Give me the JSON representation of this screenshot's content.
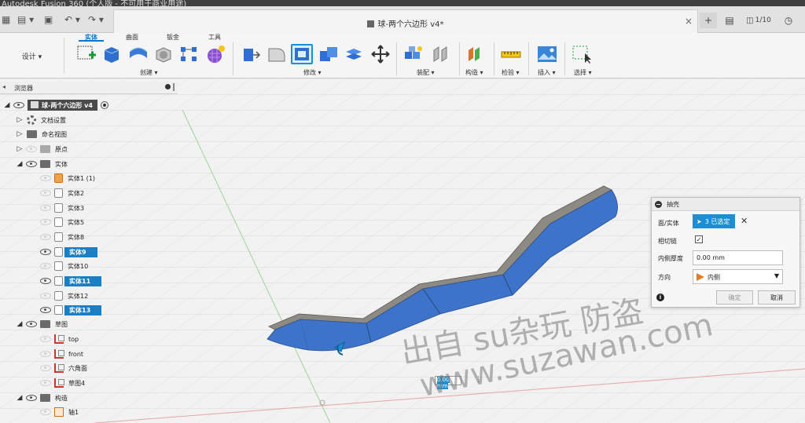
{
  "window": {
    "title": "Autodesk Fusion 360 (个人版 - 不可用于商业用途)"
  },
  "document_tab": {
    "title": "球-两个六边形 v4*",
    "close": "×"
  },
  "quick_access": {
    "grid": "▦",
    "file": "▤ ▾",
    "save": "▣",
    "undo": "↶ ▾",
    "redo": "↷ ▾"
  },
  "top_right": {
    "add_tab": "+",
    "chat": "▤",
    "jobs": "1/10",
    "clock": "◷"
  },
  "toolbar": {
    "design": "设计 ▾",
    "tabs": [
      "实体",
      "曲面",
      "钣金",
      "工具"
    ],
    "groups": {
      "create": "创建 ▾",
      "modify": "修改 ▾",
      "assemble": "装配 ▾",
      "construct": "构造 ▾",
      "inspect": "检验 ▾",
      "insert": "插入 ▾",
      "select": "选择 ▾"
    }
  },
  "browser": {
    "title": "浏览器",
    "collapse": "◂",
    "root": "球-两个六边形 v4",
    "items": {
      "doc_settings": "文档设置",
      "named_views": "命名视图",
      "origin": "原点",
      "bodies": "实体",
      "body1": "实体1 (1)",
      "body2": "实体2",
      "body3": "实体3",
      "body5": "实体5",
      "body8": "实体8",
      "body9": "实体9",
      "body10": "实体10",
      "body11": "实体11",
      "body12": "实体12",
      "body13": "实体13",
      "sketches": "草图",
      "sk_top": "top",
      "sk_front": "front",
      "sk_hex": "六角面",
      "sk4": "草图4",
      "construction": "构造",
      "axis1": "轴1"
    }
  },
  "shell_dialog": {
    "title": "抽壳",
    "face_label": "面/实体",
    "selected": "3 已选定",
    "clear": "✕",
    "tangent_label": "相切链",
    "tangent_checked": "✓",
    "inside_label": "内侧厚度",
    "inside_value": "0.00 mm",
    "direction_label": "方向",
    "direction_value": "内侧",
    "ok": "确定",
    "cancel": "取消",
    "info": "i"
  },
  "viewport": {
    "dim_value": "0.00 mm",
    "dim_menu": "⋮"
  },
  "watermark": {
    "line1": "出自 su杂玩 防盗",
    "line2": "www.suzawan.com"
  },
  "colors": {
    "accent": "#1b8fd6",
    "body_blue": "#3d73c8",
    "body_edge": "#7d7a74"
  }
}
